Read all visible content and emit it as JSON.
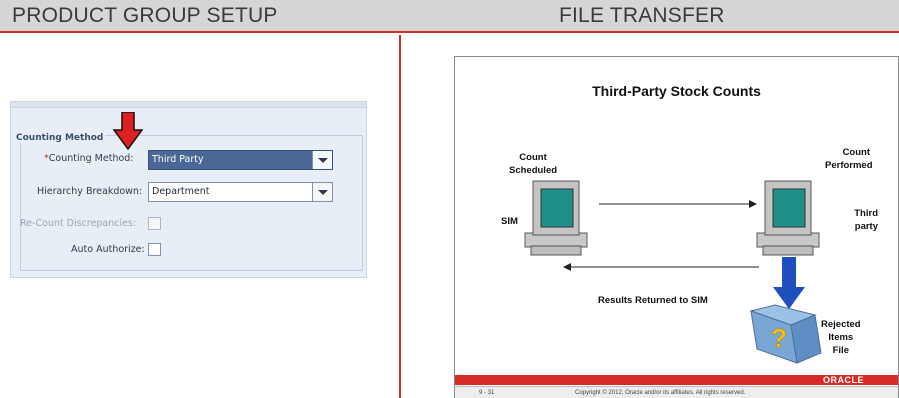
{
  "header": {
    "left_title": "PRODUCT GROUP SETUP",
    "right_title": "FILE TRANSFER"
  },
  "form": {
    "section_label": "Counting Method",
    "counting_method": {
      "required_mark": "*",
      "label": "Counting Method:",
      "value": "Third Party"
    },
    "hierarchy_breakdown": {
      "label": "Hierarchy Breakdown:",
      "value": "Department"
    },
    "recount_discrepancies": {
      "label": "Re-Count Discrepancies:",
      "checked": false,
      "disabled": true
    },
    "auto_authorize": {
      "label": "Auto Authorize:",
      "checked": false
    }
  },
  "slide": {
    "title": "Third-Party Stock Counts",
    "count_scheduled": [
      "Count",
      "Scheduled"
    ],
    "sim": "SIM",
    "count_performed": [
      "Count",
      "Performed"
    ],
    "third_party": [
      "Third",
      "party"
    ],
    "results_returned": "Results Returned to SIM",
    "rejected_items": [
      "Rejected",
      "Items",
      "File"
    ],
    "brand": "ORACLE",
    "page_number": "9 - 31",
    "copyright": "Copyright © 2012, Oracle and/or its affiliates. All rights reserved."
  },
  "colors": {
    "accent_red": "#d72b27",
    "selected_blue": "#4a6796",
    "monitor_screen": "#1e8f86",
    "download_arrow": "#1f4fbf",
    "folder_blue": "#7aa6d6",
    "question_mark": "#f4c21c"
  }
}
